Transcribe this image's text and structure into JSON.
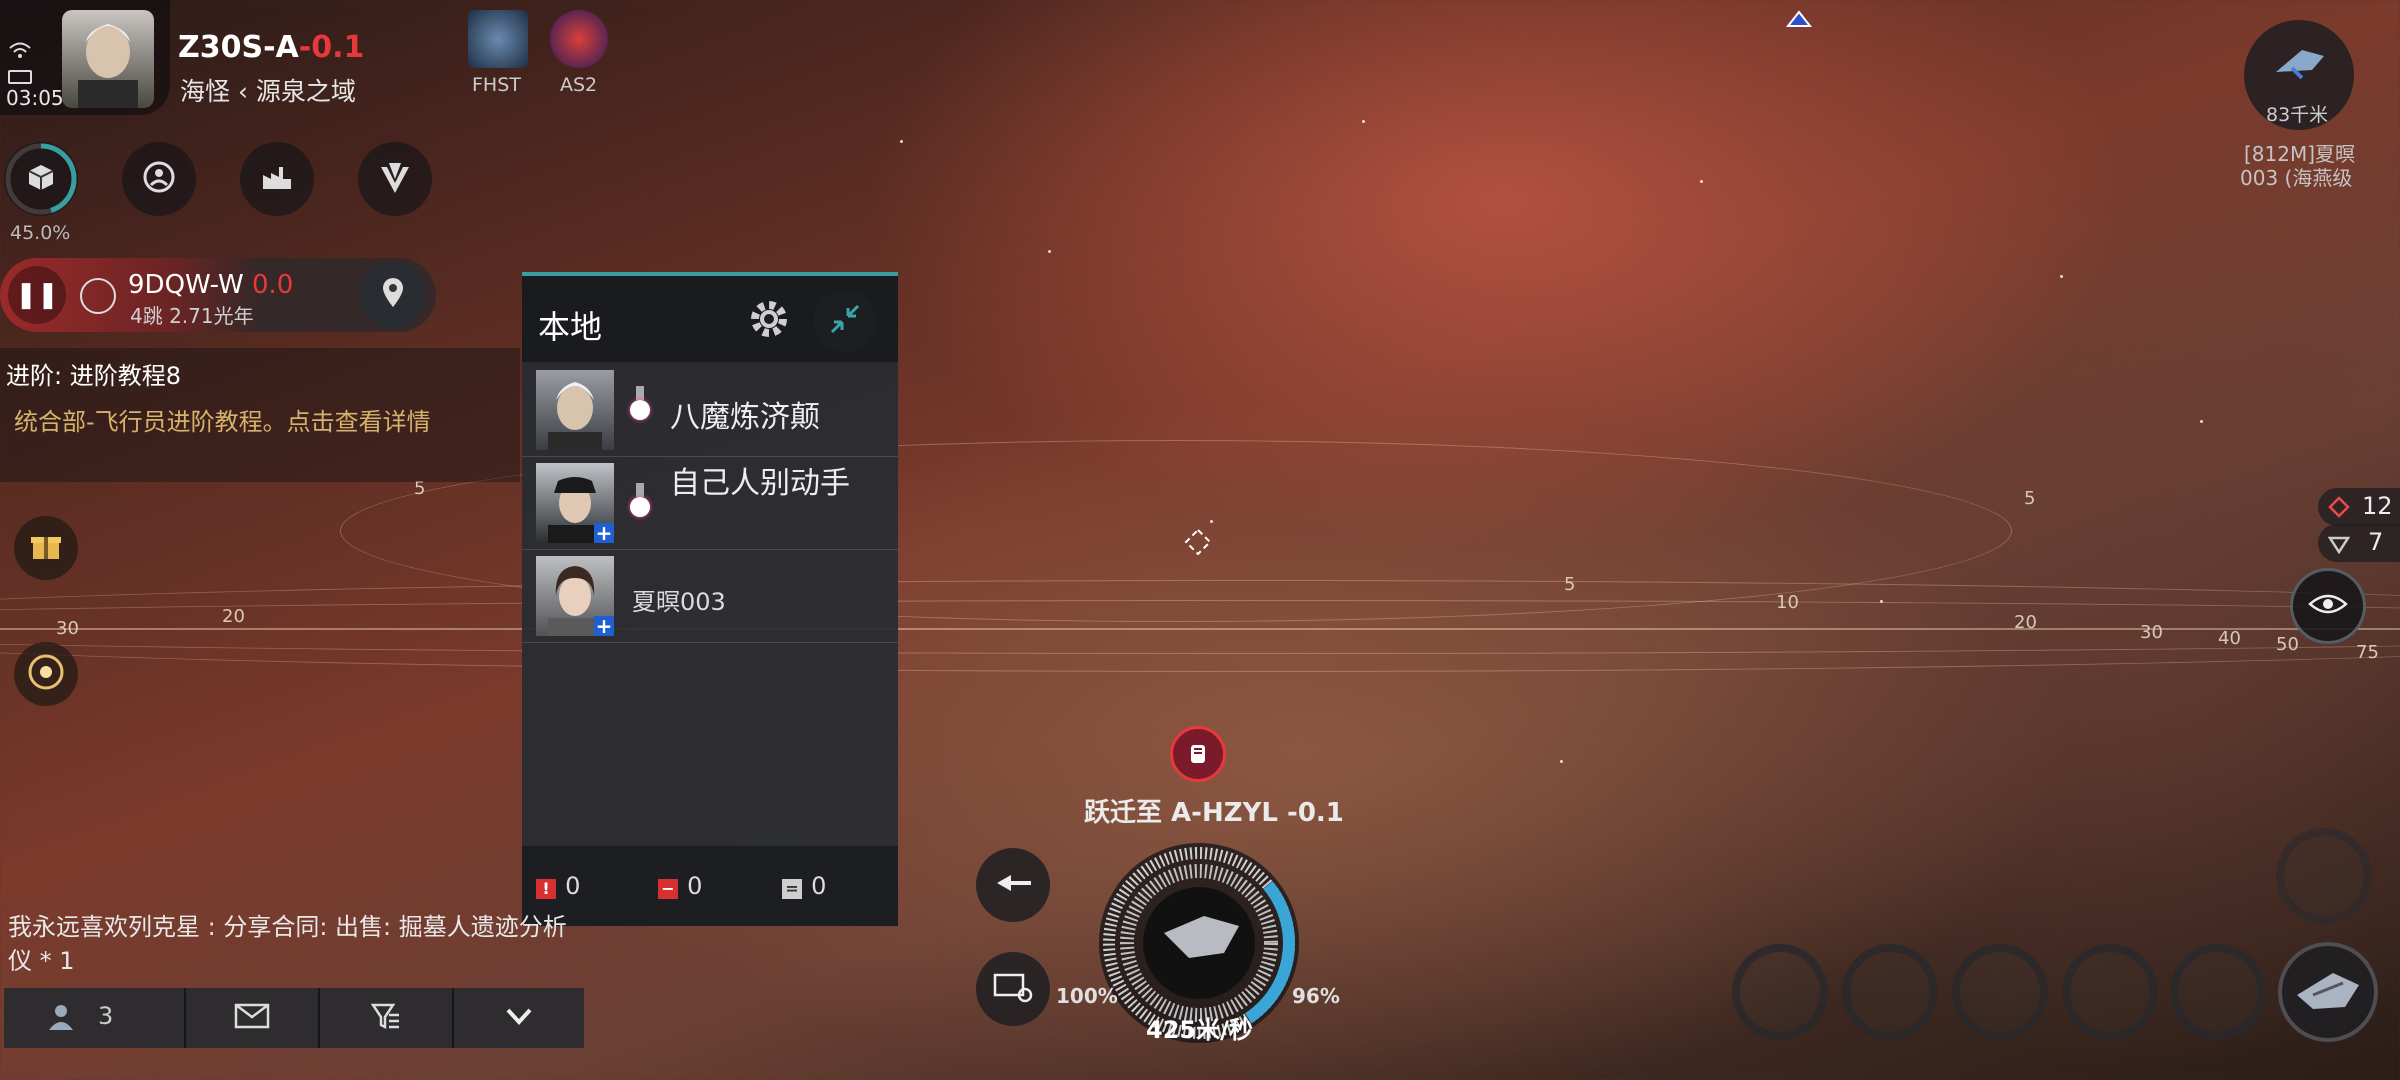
{
  "status": {
    "time": "03:05"
  },
  "system": {
    "name": "Z30S-A",
    "security": "-0.1",
    "constellation": "海怪",
    "region": "源泉之域"
  },
  "corps": [
    {
      "ticker": "FHST"
    },
    {
      "ticker": "AS2"
    }
  ],
  "cargo": {
    "percent": "45.0%",
    "fill": 0.45
  },
  "toolbar_icons": [
    "cargo-icon",
    "character-icon",
    "industry-icon",
    "alliance-icon"
  ],
  "route": {
    "destination": "9DQW-W",
    "security": "0.0",
    "jumps": "4跳 2.71光年"
  },
  "tutorial": {
    "title": "进阶: 进阶教程8",
    "detail": "统合部-飞行员进阶教程。点击查看详情"
  },
  "chat_panel": {
    "title": "本地",
    "members": [
      {
        "name": "八魔炼济颠"
      },
      {
        "name": "自己人别动手"
      },
      {
        "name": "夏暝003"
      }
    ],
    "counts": {
      "hostile": "0",
      "neutral": "0",
      "other": "0"
    }
  },
  "chat_message": "我永远喜欢列克星 : 分享合同: 出售: 掘墓人遗迹分析仪 * 1",
  "bottom_bar": {
    "online": "3"
  },
  "overview": {
    "distance": "83千米",
    "target_line1": "[812M]夏暝",
    "target_line2": "003 (海燕级",
    "count_a": "12",
    "count_b": "7"
  },
  "orbit_labels": [
    "5",
    "30",
    "20",
    "5",
    "5",
    "10",
    "20",
    "30",
    "40",
    "50",
    "75"
  ],
  "ship": {
    "warp_text": "跃迁至 A-HZYL -0.1",
    "speed": "425米/秒",
    "shield": "100%",
    "capacitor": "96%"
  },
  "colors": {
    "security_red": "#e8383a",
    "accent_teal": "#3a9da0",
    "tutorial_gold": "#d6b26a",
    "cap_blue": "#3aa6d8"
  }
}
